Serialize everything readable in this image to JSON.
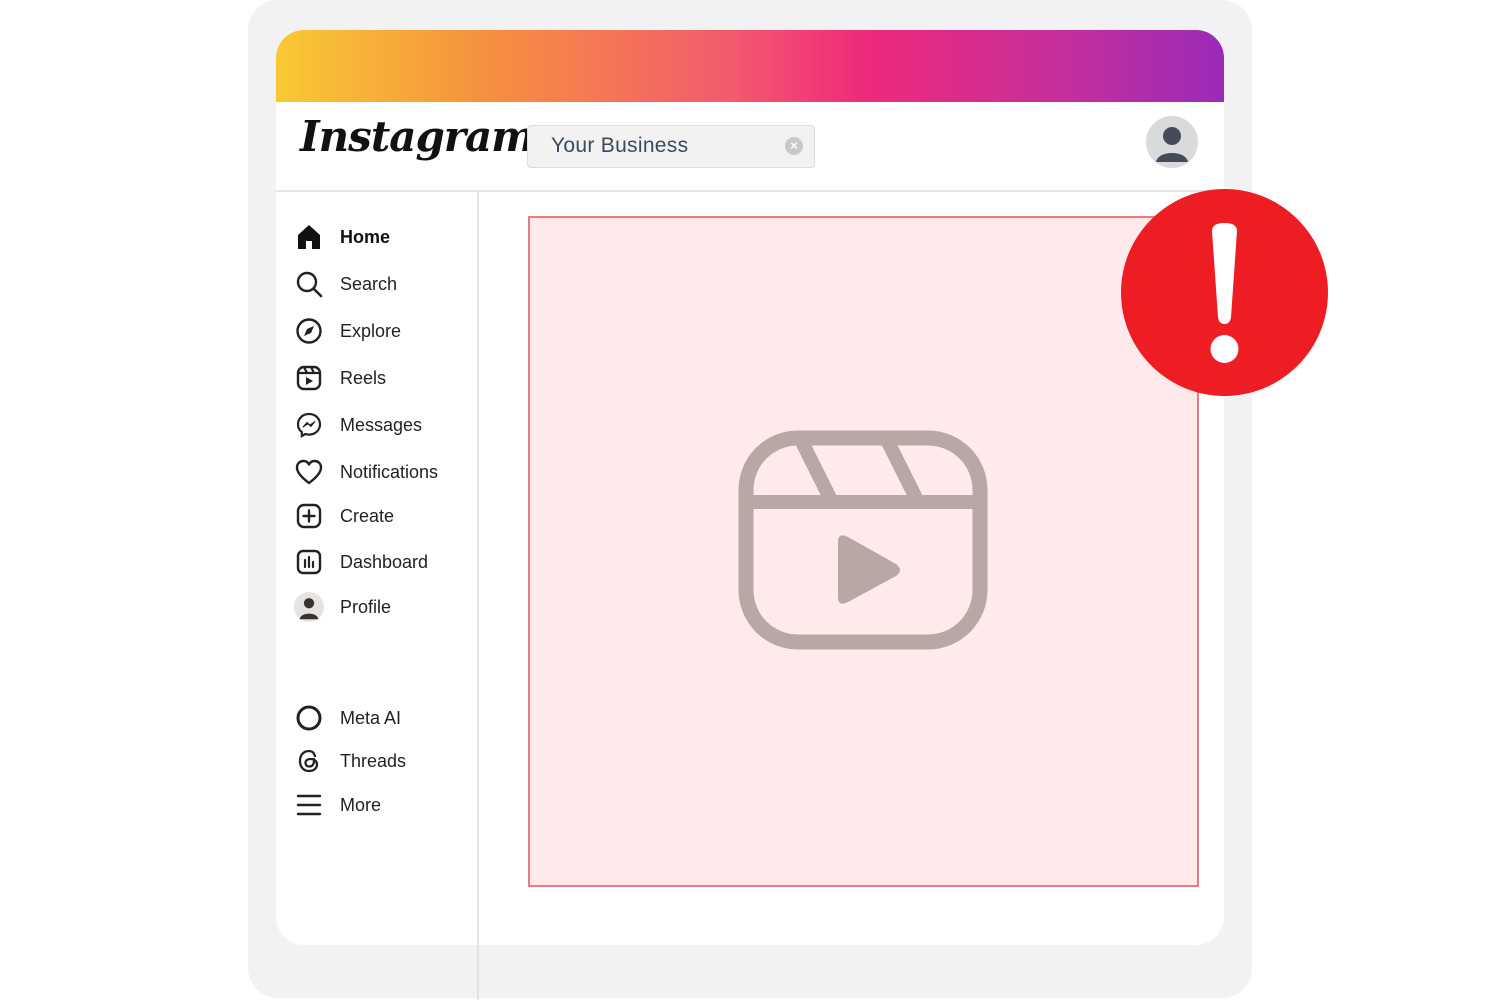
{
  "app": {
    "logo_text": "Instagram",
    "brand_gradient": [
      "#f9c934",
      "#f6913f",
      "#ee2a7b",
      "#9b2ab9"
    ]
  },
  "search": {
    "value": "Your Business",
    "clear_icon": "clear-circle-icon"
  },
  "header": {
    "avatar_icon": "user-avatar-icon"
  },
  "sidebar": {
    "items": [
      {
        "label": "Home",
        "icon": "home-icon",
        "active": true
      },
      {
        "label": "Search",
        "icon": "search-icon"
      },
      {
        "label": "Explore",
        "icon": "compass-icon"
      },
      {
        "label": "Reels",
        "icon": "reels-icon"
      },
      {
        "label": "Messages",
        "icon": "messenger-icon"
      },
      {
        "label": "Notifications",
        "icon": "heart-icon"
      },
      {
        "label": "Create",
        "icon": "plus-square-icon"
      },
      {
        "label": "Dashboard",
        "icon": "dashboard-icon"
      },
      {
        "label": "Profile",
        "icon": "profile-avatar-icon"
      }
    ],
    "bottom_items": [
      {
        "label": "Meta AI",
        "icon": "meta-ai-ring-icon"
      },
      {
        "label": "Threads",
        "icon": "threads-icon"
      },
      {
        "label": "More",
        "icon": "menu-icon"
      }
    ]
  },
  "main": {
    "placeholder_icon": "reels-video-icon",
    "placeholder_bg": "#feeaea",
    "placeholder_border": "#e97a85"
  },
  "alert": {
    "icon": "exclamation-icon",
    "color": "#ee1d24"
  }
}
